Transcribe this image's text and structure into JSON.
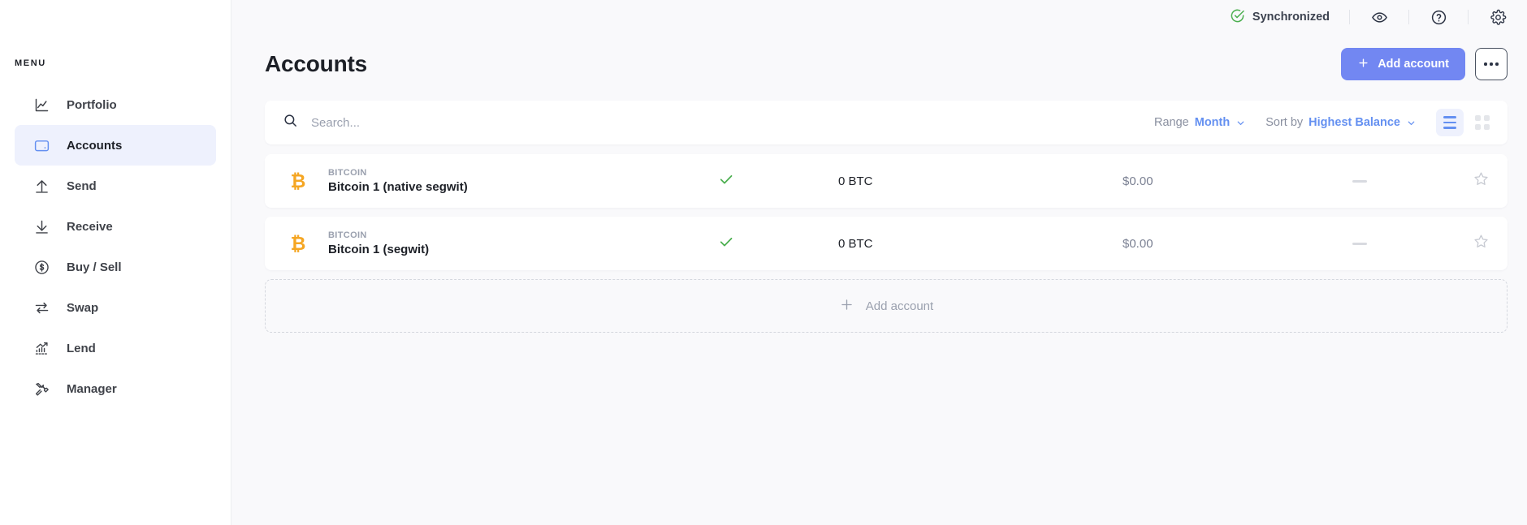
{
  "sidebar": {
    "section_label": "MENU",
    "items": [
      {
        "id": "portfolio",
        "label": "Portfolio",
        "icon": "chart-line-icon",
        "active": false
      },
      {
        "id": "accounts",
        "label": "Accounts",
        "icon": "wallet-icon",
        "active": true
      },
      {
        "id": "send",
        "label": "Send",
        "icon": "arrow-up-icon",
        "active": false
      },
      {
        "id": "receive",
        "label": "Receive",
        "icon": "arrow-down-icon",
        "active": false
      },
      {
        "id": "buysell",
        "label": "Buy / Sell",
        "icon": "dollar-circle-icon",
        "active": false
      },
      {
        "id": "swap",
        "label": "Swap",
        "icon": "swap-arrows-icon",
        "active": false
      },
      {
        "id": "lend",
        "label": "Lend",
        "icon": "bar-chart-up-icon",
        "active": false
      },
      {
        "id": "manager",
        "label": "Manager",
        "icon": "tools-icon",
        "active": false
      }
    ]
  },
  "topbar": {
    "sync_status": "Synchronized",
    "sync_icon": "check-circle-icon",
    "icons": [
      {
        "name": "eye-icon"
      },
      {
        "name": "help-circle-icon"
      },
      {
        "name": "gear-icon"
      }
    ]
  },
  "header": {
    "title": "Accounts",
    "add_account_label": "Add account",
    "add_account_icon": "plus-icon",
    "more_button_icon": "ellipsis-icon"
  },
  "toolbar": {
    "search_icon": "search-icon",
    "search_value": "",
    "search_placeholder": "Search...",
    "range_label": "Range",
    "range_value": "Month",
    "sort_label": "Sort by",
    "sort_value": "Highest Balance",
    "chevron_icon": "chevron-down-icon",
    "view_list_icon": "list-view-icon",
    "view_grid_icon": "grid-view-icon",
    "active_view": "list"
  },
  "accounts": {
    "rows": [
      {
        "ticker": "BITCOIN",
        "name": "Bitcoin 1 (native segwit)",
        "coin_symbol": "₿",
        "coin_color": "#f5a623",
        "status_icon": "check-icon",
        "amount": "0 BTC",
        "fiat": "$0.00",
        "trend": "—",
        "star_icon": "star-outline-icon"
      },
      {
        "ticker": "BITCOIN",
        "name": "Bitcoin 1 (segwit)",
        "coin_symbol": "₿",
        "coin_color": "#f5a623",
        "status_icon": "check-icon",
        "amount": "0 BTC",
        "fiat": "$0.00",
        "trend": "—",
        "star_icon": "star-outline-icon"
      }
    ],
    "add_row_label": "Add account",
    "add_row_icon": "plus-icon"
  },
  "colors": {
    "accent_blue": "#6490f1",
    "primary_button": "#7287f2",
    "active_nav_bg": "#eef1fd",
    "success_green": "#4caf50",
    "bitcoin_orange": "#f5a623",
    "page_bg": "#f9f9fb",
    "card_bg": "#ffffff"
  }
}
